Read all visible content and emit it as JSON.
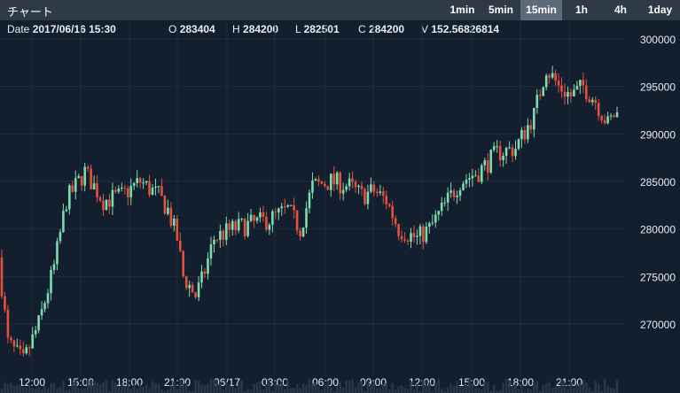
{
  "header": {
    "title": "チャート",
    "intervals": [
      "1min",
      "5min",
      "15min",
      "1h",
      "4h",
      "1day"
    ],
    "active_interval": "15min"
  },
  "ohlc": {
    "date_label": "Date",
    "date_value": "2017/06/16 15:30",
    "open_label": "O",
    "open_value": "283404",
    "high_label": "H",
    "high_value": "284200",
    "low_label": "L",
    "low_value": "282501",
    "close_label": "C",
    "close_value": "284200",
    "volume_label": "V",
    "volume_value": "152.56826814"
  },
  "colors": {
    "background": "#131f2e",
    "up": "#7ddbb0",
    "down": "#e4513c",
    "grid": "#1f2c3c",
    "topbar": "#2f3a47",
    "active_tab": "#5d6a78"
  },
  "chart_data": {
    "type": "candlestick",
    "ylim": [
      265000,
      302000
    ],
    "y_ticks": [
      270000,
      275000,
      280000,
      285000,
      290000,
      295000,
      300000
    ],
    "x_labels": [
      "12:00",
      "15:00",
      "18:00",
      "21:00",
      "06/17",
      "03:00",
      "06:00",
      "09:00",
      "12:00",
      "15:00",
      "18:00",
      "21:00"
    ],
    "bar_interval": "15min",
    "legend": "none",
    "grid": true,
    "volume_bars": true,
    "trend_points": [
      [
        0,
        277000
      ],
      [
        3,
        268000
      ],
      [
        8,
        266000
      ],
      [
        13,
        270000
      ],
      [
        18,
        276000
      ],
      [
        22,
        283000
      ],
      [
        28,
        286000
      ],
      [
        34,
        283000
      ],
      [
        40,
        283500
      ],
      [
        46,
        285000
      ],
      [
        52,
        283500
      ],
      [
        55,
        282000
      ],
      [
        58,
        279000
      ],
      [
        60,
        275000
      ],
      [
        64,
        273000
      ],
      [
        66,
        274500
      ],
      [
        70,
        279000
      ],
      [
        76,
        280000
      ],
      [
        82,
        280500
      ],
      [
        88,
        281000
      ],
      [
        94,
        282000
      ],
      [
        98,
        280000
      ],
      [
        102,
        284500
      ],
      [
        108,
        285000
      ],
      [
        114,
        284500
      ],
      [
        118,
        283500
      ],
      [
        122,
        284000
      ],
      [
        126,
        283000
      ],
      [
        130,
        280000
      ],
      [
        136,
        279000
      ],
      [
        140,
        280000
      ],
      [
        146,
        283000
      ],
      [
        150,
        285000
      ],
      [
        156,
        286000
      ],
      [
        162,
        288000
      ],
      [
        168,
        288500
      ],
      [
        174,
        292000
      ],
      [
        178,
        297000
      ],
      [
        182,
        295000
      ],
      [
        186,
        294000
      ],
      [
        190,
        295000
      ],
      [
        194,
        293500
      ],
      [
        198,
        291000
      ],
      [
        200,
        292000
      ]
    ]
  }
}
